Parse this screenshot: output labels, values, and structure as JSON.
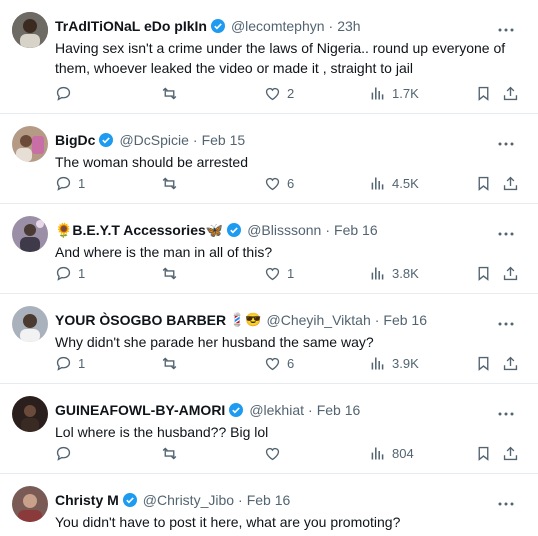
{
  "tweets": [
    {
      "name": "TrAdITiONaL eDo pIkIn",
      "verified": true,
      "emoji": "",
      "handle": "@lecomtephyn",
      "time": "23h",
      "text": "Having sex isn't a crime under the laws of Nigeria.. round up everyone of them, whoever leaked the video or made it , straight to jail",
      "replies": "",
      "retweets": "",
      "likes": "2",
      "views": "1.7K"
    },
    {
      "name": "BigDc",
      "verified": true,
      "emoji": "",
      "handle": "@DcSpicie",
      "time": "Feb 15",
      "text": "The woman should be arrested",
      "replies": "1",
      "retweets": "",
      "likes": "6",
      "views": "4.5K"
    },
    {
      "name": "🌻B.E.Y.T Accessories🦋",
      "verified": true,
      "emoji": "",
      "handle": "@Blisssonn",
      "time": "Feb 16",
      "text": "And where is the man in all of this?",
      "replies": "1",
      "retweets": "",
      "likes": "1",
      "views": "3.8K"
    },
    {
      "name": "YOUR ÒSOGBO BARBER",
      "verified": false,
      "emoji": "💈😎",
      "handle": "@Cheyih_Viktah",
      "time": "Feb 16",
      "text": "Why didn't she parade her husband the same way?",
      "replies": "1",
      "retweets": "",
      "likes": "6",
      "views": "3.9K"
    },
    {
      "name": "GUINEAFOWL-BY-AMORI",
      "verified": true,
      "emoji": "",
      "handle": "@lekhiat",
      "time": "Feb 16",
      "text": "Lol where is the husband?? Big lol",
      "replies": "",
      "retweets": "",
      "likes": "",
      "views": "804"
    },
    {
      "name": "Christy M",
      "verified": true,
      "emoji": "",
      "handle": "@Christy_Jibo",
      "time": "Feb 16",
      "text": "You didn't have to post it here, what are you promoting?",
      "replies": "",
      "retweets": "",
      "likes": "",
      "views": ""
    }
  ],
  "colors": {
    "verified": "#1d9bf0",
    "muted": "#536471",
    "text": "#0f1419",
    "divider": "#e6ecf0"
  },
  "icons": [
    "reply-icon",
    "retweet-icon",
    "like-icon",
    "views-icon",
    "bookmark-icon",
    "share-icon",
    "more-icon",
    "verified-badge-icon"
  ]
}
